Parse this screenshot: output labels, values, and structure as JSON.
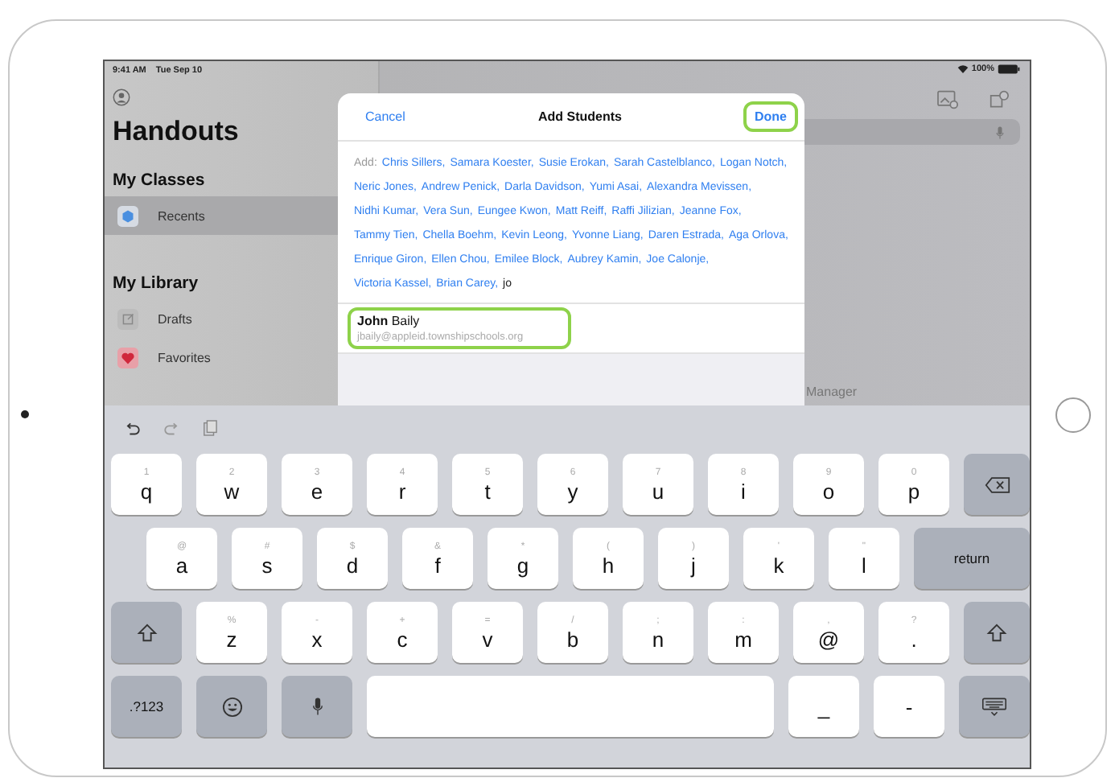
{
  "status_bar": {
    "time": "9:41 AM",
    "date": "Tue Sep 10",
    "battery": "100%"
  },
  "sidebar": {
    "title": "Handouts",
    "sections": [
      {
        "header": "My Classes",
        "items": [
          {
            "label": "Recents",
            "selected": true
          }
        ]
      },
      {
        "header": "My Library",
        "items": [
          {
            "label": "Drafts",
            "selected": false
          },
          {
            "label": "Favorites",
            "selected": false
          }
        ]
      }
    ]
  },
  "main": {
    "partial_text": "Manager"
  },
  "sheet": {
    "cancel": "Cancel",
    "title": "Add Students",
    "done": {
      "label": "Done",
      "highlighted": true
    },
    "add_label": "Add:",
    "recipients": [
      "Chris Sillers,",
      "Samara Koester,",
      "Susie Erokan,",
      "Sarah Castelblanco,",
      "Logan Notch,",
      "Neric Jones,",
      "Andrew Penick,",
      "Darla Davidson,",
      "Yumi Asai,",
      "Alexandra Mevissen,",
      "Nidhi Kumar,",
      "Vera Sun,",
      "Eungee Kwon,",
      "Matt Reiff,",
      "Raffi Jilizian,",
      "Jeanne Fox,",
      "Tammy Tien,",
      "Chella Boehm,",
      "Kevin Leong,",
      "Yvonne Liang,",
      "Daren Estrada,",
      "Aga Orlova,",
      "Enrique Giron,",
      "Ellen Chou,",
      "Emilee Block,",
      "Aubrey Kamin,",
      "Joe Calonje,",
      "Victoria Kassel,",
      "Brian Carey,"
    ],
    "typed": "jo",
    "suggestion": {
      "name": "**John** Baily",
      "email": "jbaily@appleid.townshipschools.org",
      "highlighted": true
    }
  },
  "keyboard": {
    "rows": [
      {
        "keys": [
          {
            "kind": "letter",
            "label": "q",
            "hint": "1"
          },
          {
            "kind": "letter",
            "label": "w",
            "hint": "2"
          },
          {
            "kind": "letter",
            "label": "e",
            "hint": "3"
          },
          {
            "kind": "letter",
            "label": "r",
            "hint": "4"
          },
          {
            "kind": "letter",
            "label": "t",
            "hint": "5"
          },
          {
            "kind": "letter",
            "label": "y",
            "hint": "6"
          },
          {
            "kind": "letter",
            "label": "u",
            "hint": "7"
          },
          {
            "kind": "letter",
            "label": "i",
            "hint": "8"
          },
          {
            "kind": "letter",
            "label": "o",
            "hint": "9"
          },
          {
            "kind": "letter",
            "label": "p",
            "hint": "0"
          },
          {
            "kind": "delete"
          }
        ]
      },
      {
        "keys": [
          {
            "kind": "letter",
            "label": "a",
            "hint": "@"
          },
          {
            "kind": "letter",
            "label": "s",
            "hint": "#"
          },
          {
            "kind": "letter",
            "label": "d",
            "hint": "$"
          },
          {
            "kind": "letter",
            "label": "f",
            "hint": "&"
          },
          {
            "kind": "letter",
            "label": "g",
            "hint": "*"
          },
          {
            "kind": "letter",
            "label": "h",
            "hint": "("
          },
          {
            "kind": "letter",
            "label": "j",
            "hint": ")"
          },
          {
            "kind": "letter",
            "label": "k",
            "hint": "'"
          },
          {
            "kind": "letter",
            "label": "l",
            "hint": "\""
          },
          {
            "kind": "text",
            "label": "return"
          }
        ]
      },
      {
        "keys": [
          {
            "kind": "shift"
          },
          {
            "kind": "letter",
            "label": "z",
            "hint": "%"
          },
          {
            "kind": "letter",
            "label": "x",
            "hint": "-"
          },
          {
            "kind": "letter",
            "label": "c",
            "hint": "+"
          },
          {
            "kind": "letter",
            "label": "v",
            "hint": "="
          },
          {
            "kind": "letter",
            "label": "b",
            "hint": "/"
          },
          {
            "kind": "letter",
            "label": "n",
            "hint": ";"
          },
          {
            "kind": "letter",
            "label": "m",
            "hint": ":"
          },
          {
            "kind": "letter",
            "label": "@",
            "hint": ","
          },
          {
            "kind": "letter",
            "label": ".",
            "hint": "?"
          },
          {
            "kind": "shift"
          }
        ]
      },
      {
        "keys": [
          {
            "kind": "text",
            "label": ".?123"
          },
          {
            "kind": "emoji"
          },
          {
            "kind": "mic"
          },
          {
            "kind": "space"
          },
          {
            "kind": "letter",
            "label": "_"
          },
          {
            "kind": "letter",
            "label": "-"
          },
          {
            "kind": "hide"
          }
        ]
      }
    ]
  }
}
